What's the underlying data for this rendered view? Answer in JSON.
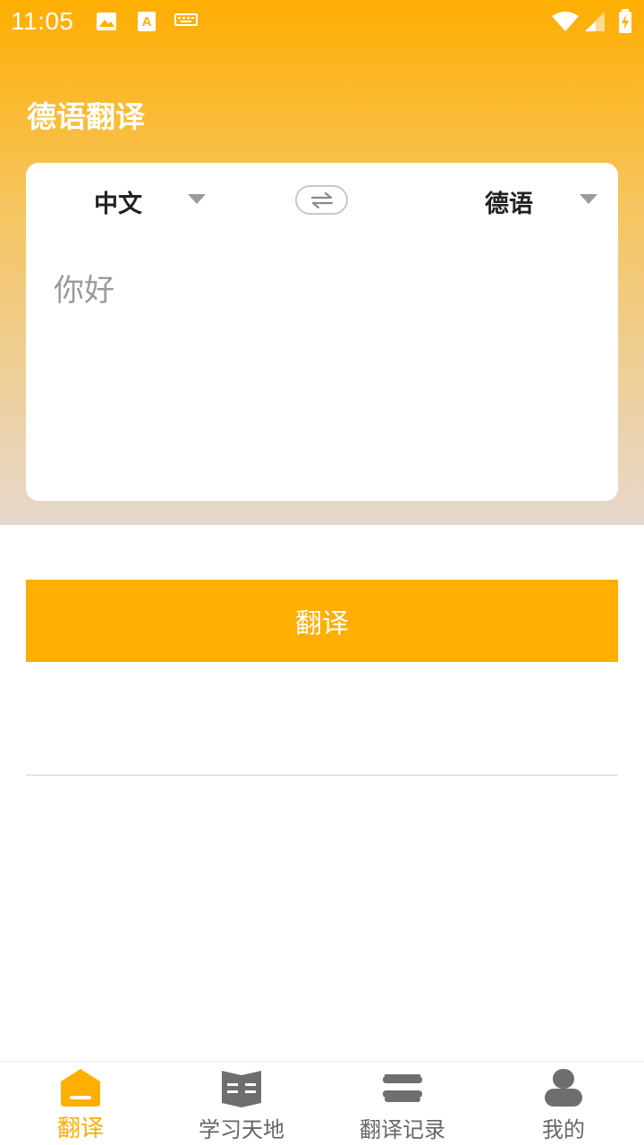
{
  "status_bar": {
    "time": "11:05"
  },
  "header": {
    "title": "德语翻译"
  },
  "translator": {
    "source_lang": "中文",
    "target_lang": "德语",
    "input_text": "你好"
  },
  "actions": {
    "translate_label": "翻译"
  },
  "bottom_nav": {
    "items": [
      {
        "label": "翻译",
        "icon": "home-icon",
        "active": true
      },
      {
        "label": "学习天地",
        "icon": "book-icon",
        "active": false
      },
      {
        "label": "翻译记录",
        "icon": "history-icon",
        "active": false
      },
      {
        "label": "我的",
        "icon": "user-icon",
        "active": false
      }
    ]
  },
  "colors": {
    "accent": "#FFAE02",
    "inactive": "#666666"
  }
}
